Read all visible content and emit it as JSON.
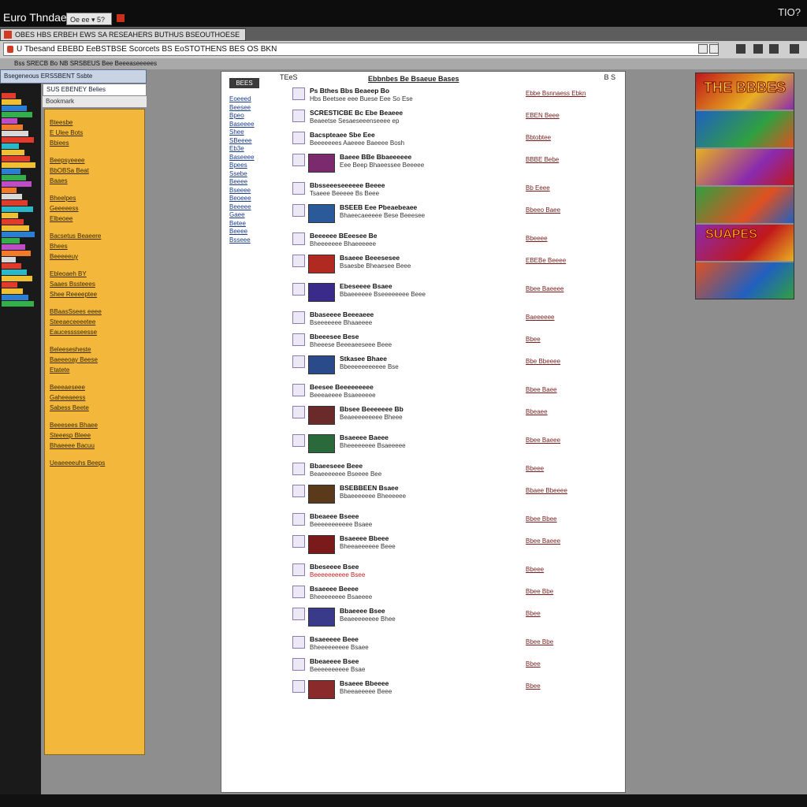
{
  "window": {
    "title": "Euro Thndaes",
    "clock": "TIO?"
  },
  "tab": {
    "label": "Oe ee ▾ 5?"
  },
  "tabstrip": {
    "label": "OBES HBS ERBEH EWS SA RESEAHERS BUTHUS BSEOUTHOESE"
  },
  "address": {
    "value": "U Tbesand EBEBD EeBSTBSE Scorcets BS EoSTOTHENS BES OS BKN"
  },
  "bookmarks": {
    "label": "Bss SRECB Bo NB SRSBEUS Bee Beeeaseeeees"
  },
  "sidebar": {
    "head": "Bsegeneous ERSSBENT Ssbte",
    "sub": "SUS EBENEY Belies",
    "sub2": "Bookmark",
    "items": [
      "Bteesbe",
      "E Ulee Bots",
      "Bbiees",
      "Beepsyeeee",
      "BbOBSa Beat",
      "Baaes",
      "Bheelpes",
      "Geeeeess",
      "Elbeoee",
      "Bacsetus Beaeere",
      "Bhees",
      "Beeeeeuy",
      "Ebleoaeh BY",
      "Saaes Bssteees",
      "Shee Reeeeptee",
      "BBaasSsees eeee",
      "Steeaeceeeetee",
      "Eaucesssseesse",
      "Beleesesheste",
      "Baeeeoay Beese",
      "Etatete",
      "Beeeaeseee",
      "Gaheeaeess",
      "Sabess Beete",
      "Beeesees Bhaee",
      "Steeesp Bleee",
      "Bhaeeee Bacuu",
      "Ueaeeeeuhs Beeps"
    ],
    "strip_colors": [
      "#e23b2b",
      "#f0c030",
      "#2a7fd4",
      "#33b04a",
      "#c04cc8",
      "#f07b2a",
      "#d8d8d8",
      "#e23b2b",
      "#2ab8c8",
      "#f0c030"
    ]
  },
  "page": {
    "logo": "BEES",
    "crumb": "TEeS",
    "heading": "Ebbnbes Be Bsaeue Bases",
    "page_num": "B S",
    "nav": [
      "Eoeeed",
      "Beesee",
      "Bpeo",
      "Baseeee",
      "Shee",
      "SBeeee",
      "Eb3e",
      "Baseeee",
      "Bpees",
      "Ssebe",
      "Beeee",
      "Bseeee",
      "Beoeee",
      "Beeeee",
      "Gaee",
      "Betee",
      "Beeee",
      "Bsseee"
    ],
    "rows": [
      {
        "title": "Ps Bthes Bbs Beaeep Bo",
        "desc": "Hbs Beetsee eee Buese Eee So Ese",
        "cat": "Ebbe Bsnnaess Ebkn",
        "thumb": null
      },
      {
        "title": "SCRESTICBE Bc Ebe Beaeee",
        "desc": "Beaeetse Sesaeseeenseeee ep",
        "cat": "EBEN Beee",
        "thumb": null
      },
      {
        "title": "Bacspteaee Sbe Eee",
        "desc": "Beeeeeees Aaeeee Baeeee Bosh",
        "cat": "Bbtobtee",
        "thumb": null
      },
      {
        "title": "Baeee BBe Bbaeeeeee",
        "desc": "Eee Beep Bhaeessee Beeeee",
        "cat": "BBBE Bebe",
        "thumb": "#7b2a6e"
      },
      {
        "title": "Bbsseeeseeeeee Beeee",
        "desc": "Tsaeee Beeeee Bs Beee",
        "cat": "Bb Eeee",
        "thumb": null
      },
      {
        "title": "BSEEB Eee Pbeaebeaee",
        "desc": "Bhaeecaeeeee Bese Beeesee",
        "cat": "Bbeeo Baee",
        "thumb": "#2a5a9a"
      },
      {
        "title": "Beeeeee BEeesee Be",
        "desc": "Bheeeeeee Bhaeeeeee",
        "cat": "Bbeeee",
        "thumb": null
      },
      {
        "title": "Bsaeee Beeesesee",
        "desc": "Bsaesbe Bheaesee Beee",
        "cat": "EBEBe Beeee",
        "thumb": "#b02a22"
      },
      {
        "title": "Ebeseeee Bsaee",
        "desc": "Bbaeeeeee Bseeeeeeee Beee",
        "cat": "Bbee Baeeee",
        "thumb": "#3a2a8a"
      },
      {
        "title": "Bbaseeee Beeeaeee",
        "desc": "Bseeeeeee Bhaaeeee",
        "cat": "Baeeeeee",
        "thumb": null
      },
      {
        "title": "Bbeeesee Bese",
        "desc": "Bheeese Beeeaeeseee Beee",
        "cat": "Bbee",
        "thumb": null
      },
      {
        "title": "Stkasee Bhaee",
        "desc": "Bbeeeeeeeeeee Bse",
        "cat": "Bbe Bbeeee",
        "thumb": "#2a4a8a"
      },
      {
        "title": "Beesee Beeeeeeeee",
        "desc": "Beeeaeeee Bsaeeeeee",
        "cat": "Bbee Baee",
        "thumb": null
      },
      {
        "title": "Bbsee Beeeeeee Bb",
        "desc": "Beaeeeeeeeee Bheee",
        "cat": "Bbeaee",
        "thumb": "#6a2a2a"
      },
      {
        "title": "Bsaeeee Baeee",
        "desc": "Bheeeeeeee Bsaeeeee",
        "cat": "Bbee Baeee",
        "thumb": "#2a6a3a"
      },
      {
        "title": "Bbaeeseee Beee",
        "desc": "Beaeeeeeee Bseeee Bee",
        "cat": "Bbeee",
        "thumb": null
      },
      {
        "title": "BSEBBEEN Bsaee",
        "desc": "Bbaeeeeeee Bheeeeee",
        "cat": "Bbaee Bbeeee",
        "thumb": "#5a3a1a"
      },
      {
        "title": "Bbeaeee Bseee",
        "desc": "Beeeeeeeeeee Bsaee",
        "cat": "Bbee Bbee",
        "thumb": null
      },
      {
        "title": "Bsaeeee Bbeee",
        "desc": "Bheeaeeeeee Beee",
        "cat": "Bbee Baeee",
        "thumb": "#7a1a1a"
      },
      {
        "title": "Bbeseeee Bsee",
        "desc": "Beeeeeeeeee Bsee",
        "cat": "Bbeee",
        "thumb": null,
        "red": true
      },
      {
        "title": "Bsaeeee Beeee",
        "desc": "Bheeeeeeee Bsaeeee",
        "cat": "Bbee Bbe",
        "thumb": null
      },
      {
        "title": "Bbaeeee Bsee",
        "desc": "Beaeeeeeeee Bhee",
        "cat": "Bbee",
        "thumb": "#3a3a8a"
      },
      {
        "title": "Bsaeeeee Beee",
        "desc": "Bheeeeeeeee Bsaee",
        "cat": "Bbee Bbe",
        "thumb": null
      },
      {
        "title": "Bbeaeeee Bsee",
        "desc": "Beeeeeeeeee Bsae",
        "cat": "Bbee",
        "thumb": null
      },
      {
        "title": "Bsaeee Bbeeee",
        "desc": "Bheeaeeeee Beee",
        "cat": "Bbee",
        "thumb": "#8a2a2a"
      }
    ]
  },
  "ad": {
    "title": "THE BBBES",
    "title2": "SUAPES",
    "colors": [
      "#c0181a",
      "#2060c0",
      "#e8b020",
      "#30a040",
      "#8a2ab0",
      "#e05020"
    ]
  }
}
